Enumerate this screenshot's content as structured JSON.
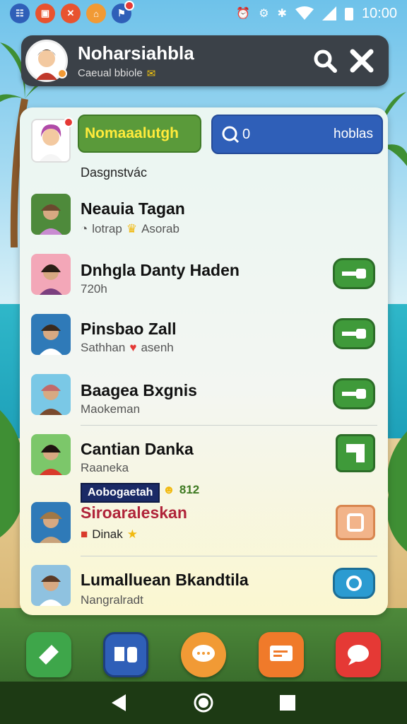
{
  "status_bar": {
    "time": "10:00",
    "notification_apps": [
      "app-icon-1",
      "app-icon-2",
      "app-icon-3",
      "app-icon-4",
      "app-icon-5"
    ]
  },
  "header": {
    "title": "Noharsiahbla",
    "subtitle": "Caeual bbiole",
    "icons": [
      "search-icon",
      "close-icon"
    ]
  },
  "me": {
    "name_button": "Nomaaalutgh",
    "search_value": "0",
    "search_tag": "hoblas",
    "section_label": "Dasgnstvác"
  },
  "contacts": [
    {
      "name": "Neauia Tagan",
      "meta": "lotrap",
      "meta2": "Asorab",
      "action": "none"
    },
    {
      "name": "Dnhgla Danty Haden",
      "meta": "720h",
      "action": "key"
    },
    {
      "name": "Pinsbao Zall",
      "meta": "Sathhan",
      "meta2": "asenh",
      "action": "key"
    },
    {
      "name": "Baagea Bxgnis",
      "meta": "Maokeman",
      "action": "key"
    },
    {
      "name": "Cantian Danka",
      "meta": "Raaneka",
      "action": "square"
    },
    {
      "name": "Siroaraleskan",
      "meta": "Dinak",
      "action": "frame"
    },
    {
      "name": "Lumalluean Bkandtila",
      "meta": "Nangralradt",
      "action": "ring"
    }
  ],
  "tag_chip": "Aobogaetah",
  "tag_extra": "812",
  "dock": [
    "ticket-icon",
    "phone-icon",
    "chat-bubble-icon",
    "message-card-icon",
    "speech-icon"
  ],
  "colors": {
    "header_bg": "#3b4148",
    "name_button_bg": "#5a9a3a",
    "search_bg": "#2f5fb8",
    "action_green": "#3f9a3a"
  }
}
